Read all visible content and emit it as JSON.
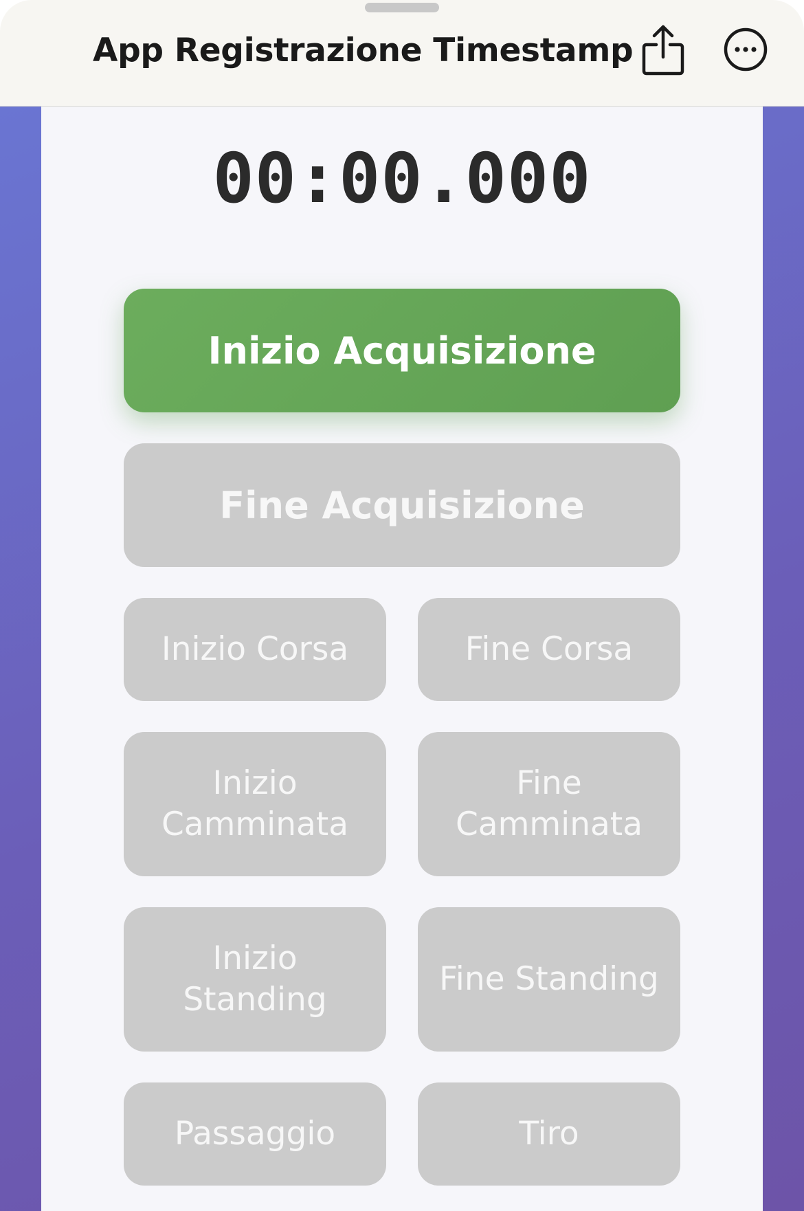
{
  "header": {
    "title": "App Registrazione Timestamp",
    "share_icon": "share-icon",
    "more_icon": "ellipsis-circle-icon"
  },
  "timer": {
    "value": "00:00.000"
  },
  "actions": {
    "start_acquisition": "Inizio Acquisizione",
    "end_acquisition": "Fine Acquisizione"
  },
  "events": [
    {
      "label": "Inizio Corsa",
      "enabled": false
    },
    {
      "label": "Fine Corsa",
      "enabled": false
    },
    {
      "label": "Inizio Camminata",
      "enabled": false
    },
    {
      "label": "Fine Camminata",
      "enabled": false
    },
    {
      "label": "Inizio Standing",
      "enabled": false
    },
    {
      "label": "Fine Standing",
      "enabled": false
    },
    {
      "label": "Passaggio",
      "enabled": false
    },
    {
      "label": "Tiro",
      "enabled": false
    }
  ],
  "colors": {
    "start_button": "#65a757",
    "disabled_button": "#cbcbcb",
    "card_background": "#f6f6fa",
    "page_gradient_start": "#6a75d2",
    "page_gradient_end": "#6d54a8",
    "header_background": "#f7f6f2",
    "timer_text": "#2b2b2b"
  }
}
